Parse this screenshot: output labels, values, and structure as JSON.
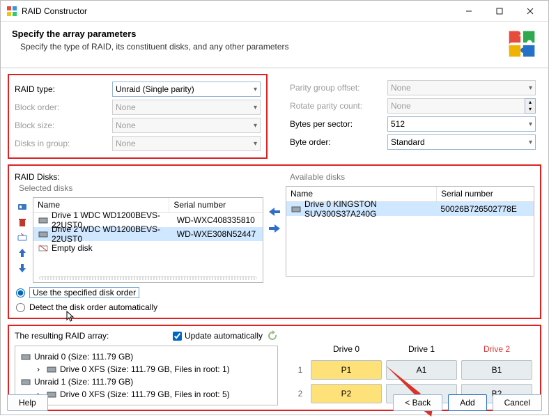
{
  "titlebar": {
    "title": "RAID Constructor"
  },
  "header": {
    "headline": "Specify the array parameters",
    "desc": "Specify the type of RAID, its constituent disks, and any other parameters"
  },
  "params_left": {
    "raid_type_label": "RAID type:",
    "raid_type_value": "Unraid (Single parity)",
    "block_order_label": "Block order:",
    "block_order_value": "None",
    "block_size_label": "Block size:",
    "block_size_value": "None",
    "disks_in_group_label": "Disks in group:",
    "disks_in_group_value": "None"
  },
  "params_right": {
    "parity_offset_label": "Parity group offset:",
    "parity_offset_value": "None",
    "rotate_parity_label": "Rotate parity count:",
    "rotate_parity_value": "None",
    "bytes_per_sector_label": "Bytes per sector:",
    "bytes_per_sector_value": "512",
    "byte_order_label": "Byte order:",
    "byte_order_value": "Standard"
  },
  "raid_disks": {
    "group_label": "RAID Disks:",
    "selected_label": "Selected disks",
    "available_label": "Available disks",
    "cols": {
      "name": "Name",
      "serial": "Serial number"
    },
    "selected": [
      {
        "name": "Drive 1 WDC WD1200BEVS-22UST0",
        "serial": "WD-WXC408335810",
        "kind": "drive"
      },
      {
        "name": "Drive 2 WDC WD1200BEVS-22UST0",
        "serial": "WD-WXE308N52447",
        "kind": "drive",
        "selected": true
      },
      {
        "name": "Empty disk",
        "serial": "",
        "kind": "empty"
      }
    ],
    "available": [
      {
        "name": "Drive 0 KINGSTON SUV300S37A240G",
        "serial": "50026B726502778E",
        "selected": true
      }
    ],
    "radio_specified": "Use the specified disk order",
    "radio_detect": "Detect the disk order automatically"
  },
  "result": {
    "label": "The resulting RAID array:",
    "auto_label": "Update automatically",
    "tree": [
      {
        "level": 0,
        "kind": "drive",
        "text": "Unraid 0 (Size: 111.79 GB)"
      },
      {
        "level": 1,
        "kind": "fs",
        "text": "Drive 0 XFS (Size: 111.79 GB, Files in root: 1)"
      },
      {
        "level": 0,
        "kind": "drive",
        "text": "Unraid 1 (Size: 111.79 GB)"
      },
      {
        "level": 1,
        "kind": "fs",
        "text": "Drive 0 XFS (Size: 111.79 GB, Files in root: 5)"
      }
    ]
  },
  "layout": {
    "headers": [
      "Drive 0",
      "Drive 1",
      "Drive 2"
    ],
    "rows": [
      {
        "idx": "1",
        "cells": [
          "P1",
          "A1",
          "B1"
        ]
      },
      {
        "idx": "2",
        "cells": [
          "P2",
          "",
          "B2"
        ]
      }
    ]
  },
  "footer": {
    "help": "Help",
    "back": "< Back",
    "add": "Add",
    "cancel": "Cancel"
  }
}
